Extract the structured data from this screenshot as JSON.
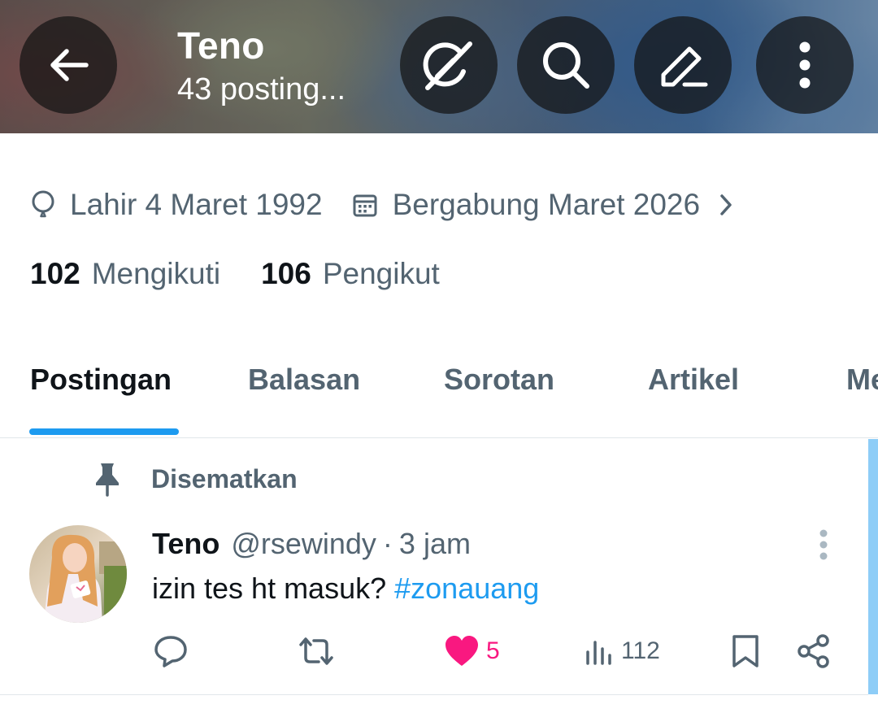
{
  "header": {
    "name": "Teno",
    "post_count": "43 posting..."
  },
  "profile": {
    "birth": "Lahir 4 Maret 1992",
    "joined": "Bergabung Maret 2026",
    "following_count": "102",
    "following_label": "Mengikuti",
    "followers_count": "106",
    "followers_label": "Pengikut"
  },
  "tabs": [
    {
      "label": "Postingan",
      "active": true
    },
    {
      "label": "Balasan",
      "active": false
    },
    {
      "label": "Sorotan",
      "active": false
    },
    {
      "label": "Artikel",
      "active": false
    },
    {
      "label": "Me",
      "active": false
    }
  ],
  "post": {
    "pinned_label": "Disematkan",
    "author": "Teno",
    "handle": "@rsewindy",
    "separator": "·",
    "time": "3 jam",
    "text": "izin tes ht masuk?",
    "hashtag": "#zonauang",
    "likes": "5",
    "views": "112",
    "liked": true
  },
  "colors": {
    "accent": "#1d9bf0",
    "like": "#f91880",
    "secondary_text": "#536471",
    "primary_text": "#0f1419"
  },
  "icons": {
    "back": "arrow-left-icon",
    "grok": "grok-icon",
    "search": "search-icon",
    "edit": "edit-pencil-icon",
    "more": "more-vertical-icon",
    "birth": "balloon-icon",
    "joined": "calendar-icon",
    "pin": "pin-icon",
    "reply": "reply-icon",
    "repost": "repost-icon",
    "like": "heart-icon",
    "views": "views-icon",
    "bookmark": "bookmark-icon",
    "share": "share-icon"
  }
}
